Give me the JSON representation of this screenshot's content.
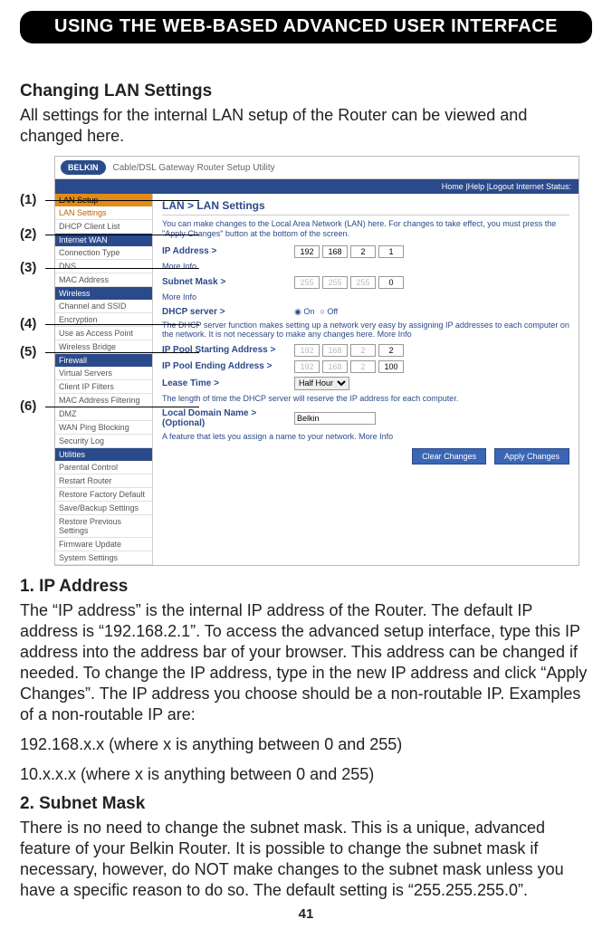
{
  "page_title": "USING THE WEB-BASED ADVANCED USER INTERFACE",
  "section_heading": "Changing LAN Settings",
  "intro_para": "All settings for the internal LAN setup of the Router can be viewed and changed here.",
  "callouts": {
    "c1": "(1)",
    "c2": "(2)",
    "c3": "(3)",
    "c4": "(4)",
    "c5": "(5)",
    "c6": "(6)"
  },
  "screenshot": {
    "brand": "BELKIN",
    "product": "Cable/DSL Gateway Router Setup Utility",
    "topbar_right": "Home |Help |Logout    Internet Status:",
    "nav": {
      "sec1": "LAN Setup",
      "items1": [
        "LAN Settings",
        "DHCP Client List"
      ],
      "sec2": "Internet WAN",
      "items2": [
        "Connection Type",
        "DNS",
        "MAC Address"
      ],
      "sec3": "Wireless",
      "items3": [
        "Channel and SSID",
        "Encryption",
        "Use as Access Point",
        "Wireless Bridge"
      ],
      "sec4": "Firewall",
      "items4": [
        "Virtual Servers",
        "Client IP Filters",
        "MAC Address Filtering",
        "DMZ",
        "WAN Ping Blocking",
        "Security Log"
      ],
      "sec5": "Utilities",
      "items5": [
        "Parental Control",
        "Restart Router",
        "Restore Factory Default",
        "Save/Backup Settings",
        "Restore Previous Settings",
        "Firmware Update",
        "System Settings"
      ]
    },
    "panel": {
      "title": "LAN > LAN Settings",
      "blurb": "You can make changes to the Local Area Network (LAN) here. For changes to take effect, you must press the \"Apply Changes\" button at the bottom of the screen.",
      "ip_label": "IP Address >",
      "ip": [
        "192",
        "168",
        "2",
        "1"
      ],
      "more_info": "More Info",
      "subnet_label": "Subnet Mask >",
      "subnet": [
        "255",
        "255",
        "255",
        "0"
      ],
      "dhcp_label": "DHCP server >",
      "on": "On",
      "off": "Off",
      "dhcp_blurb": "The DHCP server function makes setting up a network very easy by assigning IP addresses to each computer on the network. It is not necessary to make any changes here. More Info",
      "pool_start_label": "IP Pool Starting Address >",
      "pool_start": [
        "192",
        "168",
        "2",
        "2"
      ],
      "pool_end_label": "IP Pool Ending Address >",
      "pool_end": [
        "192",
        "168",
        "2",
        "100"
      ],
      "lease_label": "Lease Time >",
      "lease_value": "Half Hour",
      "lease_blurb": "The length of time the DHCP server will reserve the IP address for each computer.",
      "domain_label": "Local Domain Name > (Optional)",
      "domain_value": "Belkin",
      "domain_blurb": "A feature that lets you assign a name to your network. More Info",
      "btn_clear": "Clear Changes",
      "btn_apply": "Apply Changes"
    }
  },
  "h_ip": "1. IP Address",
  "p_ip": "The “IP address” is the internal IP address of the Router. The default IP address is “192.168.2.1”. To access the advanced setup interface, type this IP address into the address bar of your browser. This address can be changed if needed. To change the IP address, type in the new IP address and click “Apply Changes”. The IP address you choose should be a non-routable IP. Examples of a non-routable IP are:",
  "p_ex1": "192.168.x.x (where x is anything between 0 and 255)",
  "p_ex2": "10.x.x.x (where x is anything between 0 and 255)",
  "h_subnet": "2. Subnet Mask",
  "p_subnet": "There is no need to change the subnet mask. This is a unique, advanced feature of your Belkin Router. It is possible to change the subnet mask if necessary, however, do NOT make changes to the subnet mask unless you have a specific reason to do so. The default setting is “255.255.255.0”.",
  "page_number": "41"
}
